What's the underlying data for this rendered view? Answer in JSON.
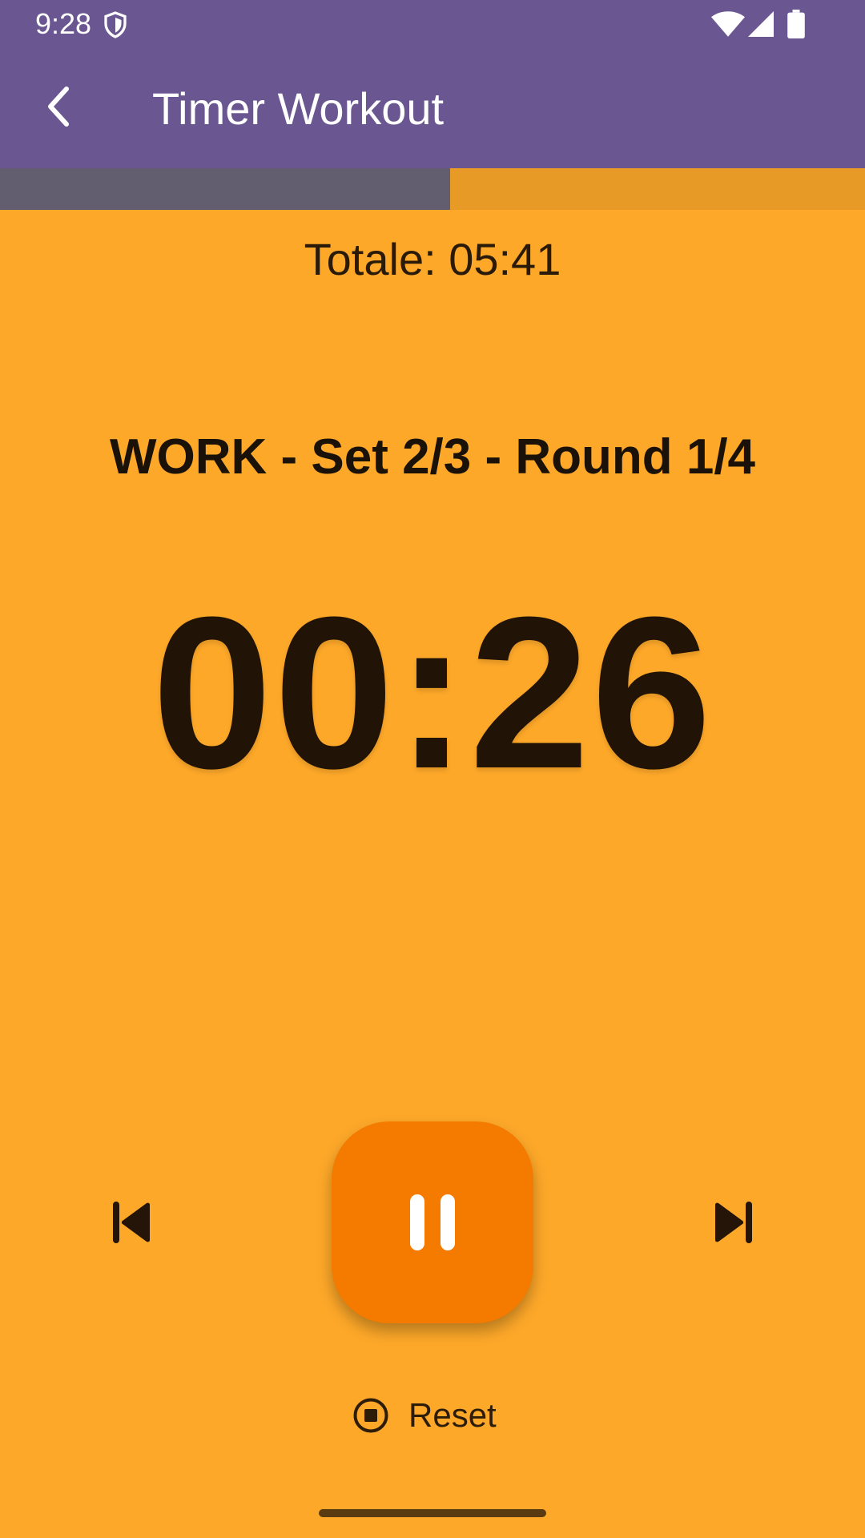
{
  "status_bar": {
    "time": "9:28",
    "icons": [
      "shield-icon",
      "wifi-icon",
      "cell-signal-icon",
      "battery-icon"
    ]
  },
  "app_bar": {
    "back_icon": "back-arrow-icon",
    "title": "Timer Workout"
  },
  "progress": {
    "fraction": 0.52,
    "fill_color": "#625D6F",
    "track_color": "#E89A26"
  },
  "workout": {
    "total_label": "Totale: 05:41",
    "phase_label": "WORK - Set 2/3 - Round 1/4",
    "countdown": "00:26"
  },
  "controls": {
    "previous_icon": "skip-previous-icon",
    "pause_icon": "pause-icon",
    "next_icon": "skip-next-icon",
    "reset_icon": "stop-circle-icon",
    "reset_label": "Reset"
  },
  "colors": {
    "background": "#FDA829",
    "app_bar": "#6A5690",
    "accent_button": "#F47A00",
    "text_dark": "#211406"
  }
}
